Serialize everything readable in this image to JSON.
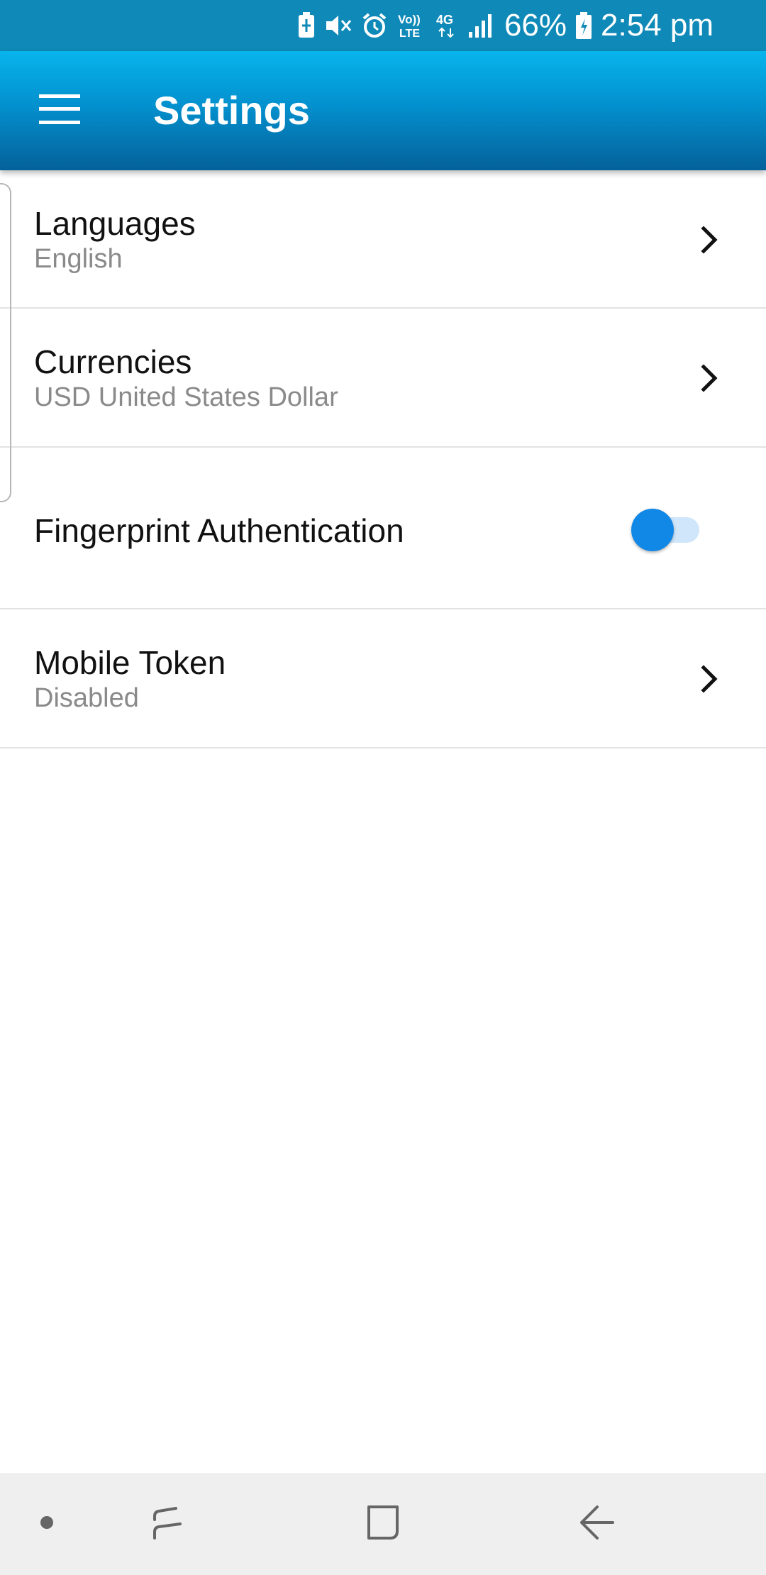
{
  "status_bar": {
    "battery_percent": "66%",
    "time": "2:54 pm",
    "network_type": "4G",
    "volte_label": "Vo)) LTE",
    "icons": [
      "battery-saver-icon",
      "mute-icon",
      "alarm-icon",
      "volte-icon",
      "4g-icon",
      "signal-icon",
      "battery-icon"
    ]
  },
  "app_bar": {
    "title": "Settings",
    "menu_icon": "hamburger-menu-icon"
  },
  "settings": {
    "languages": {
      "title": "Languages",
      "value": "English"
    },
    "currencies": {
      "title": "Currencies",
      "value": "USD United States Dollar"
    },
    "fingerprint": {
      "title": "Fingerprint Authentication",
      "enabled": false
    },
    "mobile_token": {
      "title": "Mobile Token",
      "value": "Disabled"
    }
  },
  "nav_bar": {
    "buttons": [
      "dot-icon",
      "recent-apps-icon",
      "home-icon",
      "back-icon"
    ]
  },
  "colors": {
    "status_bar": "#0f8ab8",
    "app_bar_top": "#08b4ec",
    "app_bar_bottom": "#04619a",
    "toggle_thumb": "#1187e6",
    "toggle_track": "#cfe6fb",
    "divider": "#e3e3e3",
    "subtitle": "#8a8a8a"
  }
}
